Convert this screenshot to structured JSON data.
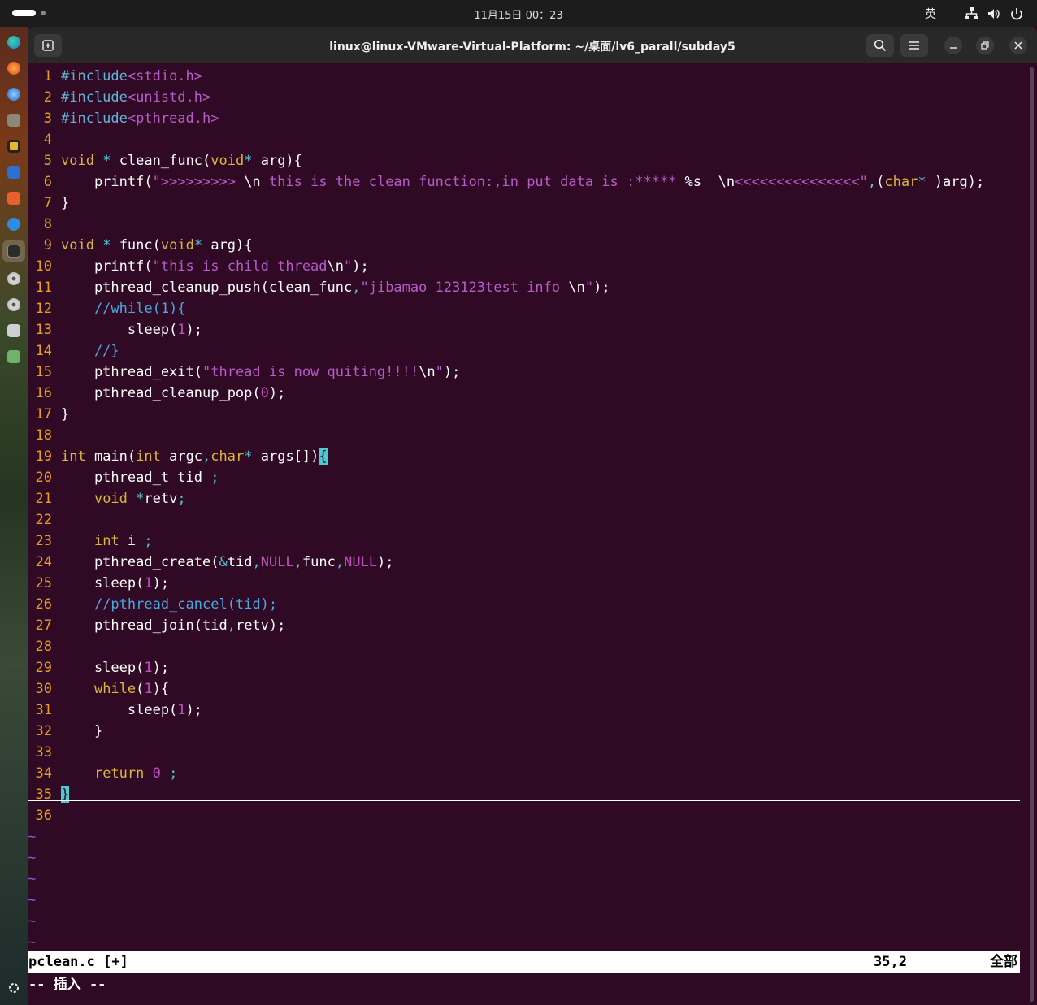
{
  "topbar": {
    "date": "11月15日",
    "time": "00：23",
    "input_method": "英",
    "tray_icons": [
      "network-icon",
      "volume-icon",
      "power-icon"
    ]
  },
  "dock": {
    "apps": [
      "edge-icon",
      "firefox-icon",
      "thunderbird-icon",
      "files-icon",
      "rhythmbox-icon",
      "writer-icon",
      "software-icon",
      "help-icon",
      "terminal-icon",
      "disc-icon",
      "disc-icon",
      "save-icon",
      "trash-icon"
    ],
    "show_apps_icon": "apps-grid-icon"
  },
  "window": {
    "title": "linux@linux-VMware-Virtual-Platform: ~/桌面/lv6_parall/subday5",
    "buttons": [
      "search-icon",
      "menu-icon",
      "minimize-icon",
      "restore-icon",
      "close-icon"
    ]
  },
  "editor": {
    "lines": [
      {
        "n": "1",
        "tokens": [
          {
            "t": "#include",
            "c": "pp"
          },
          {
            "t": "<stdio.h>",
            "c": "str"
          }
        ]
      },
      {
        "n": "2",
        "tokens": [
          {
            "t": "#include",
            "c": "pp"
          },
          {
            "t": "<unistd.h>",
            "c": "str"
          }
        ]
      },
      {
        "n": "3",
        "tokens": [
          {
            "t": "#include",
            "c": "pp"
          },
          {
            "t": "<pthread.h>",
            "c": "str"
          }
        ]
      },
      {
        "n": "4",
        "tokens": []
      },
      {
        "n": "5",
        "tokens": [
          {
            "t": "void",
            "c": "kw"
          },
          {
            "t": " ",
            "c": ""
          },
          {
            "t": "*",
            "c": "op"
          },
          {
            "t": " clean_func(",
            "c": ""
          },
          {
            "t": "void",
            "c": "kw"
          },
          {
            "t": "*",
            "c": "op"
          },
          {
            "t": " arg){",
            "c": ""
          }
        ]
      },
      {
        "n": "6",
        "tokens": [
          {
            "t": "    printf(",
            "c": ""
          },
          {
            "t": "\">>>>>>>>> ",
            "c": "str"
          },
          {
            "t": "\\n",
            "c": ""
          },
          {
            "t": " this is the clean function:,in put data is :***** ",
            "c": "str"
          },
          {
            "t": "%s",
            "c": ""
          },
          {
            "t": "  ",
            "c": "str"
          },
          {
            "t": "\\n",
            "c": ""
          },
          {
            "t": "<<<<<<<<<<<<<<<\"",
            "c": "str"
          },
          {
            "t": ",",
            "c": "op"
          },
          {
            "t": "(",
            "c": ""
          },
          {
            "t": "char",
            "c": "kw"
          },
          {
            "t": "*",
            "c": "op"
          },
          {
            "t": " )arg);",
            "c": ""
          }
        ]
      },
      {
        "n": "7",
        "tokens": [
          {
            "t": "}",
            "c": ""
          }
        ]
      },
      {
        "n": "8",
        "tokens": []
      },
      {
        "n": "9",
        "tokens": [
          {
            "t": "void",
            "c": "kw"
          },
          {
            "t": " ",
            "c": ""
          },
          {
            "t": "*",
            "c": "op"
          },
          {
            "t": " func(",
            "c": ""
          },
          {
            "t": "void",
            "c": "kw"
          },
          {
            "t": "*",
            "c": "op"
          },
          {
            "t": " arg){",
            "c": ""
          }
        ]
      },
      {
        "n": "10",
        "tokens": [
          {
            "t": "    printf(",
            "c": ""
          },
          {
            "t": "\"this is child thread",
            "c": "str"
          },
          {
            "t": "\\n",
            "c": ""
          },
          {
            "t": "\"",
            "c": "str"
          },
          {
            "t": ");",
            "c": ""
          }
        ]
      },
      {
        "n": "11",
        "tokens": [
          {
            "t": "    pthread_cleanup_push(clean_func",
            "c": ""
          },
          {
            "t": ",",
            "c": "op"
          },
          {
            "t": "\"jibamao 123123test info ",
            "c": "str"
          },
          {
            "t": "\\n",
            "c": ""
          },
          {
            "t": "\"",
            "c": "str"
          },
          {
            "t": ");",
            "c": ""
          }
        ]
      },
      {
        "n": "12",
        "tokens": [
          {
            "t": "    //while(1){",
            "c": "com"
          }
        ]
      },
      {
        "n": "13",
        "tokens": [
          {
            "t": "        sleep(",
            "c": ""
          },
          {
            "t": "1",
            "c": "num"
          },
          {
            "t": ");",
            "c": ""
          }
        ]
      },
      {
        "n": "14",
        "tokens": [
          {
            "t": "    //}",
            "c": "com"
          }
        ]
      },
      {
        "n": "15",
        "tokens": [
          {
            "t": "    pthread_exit(",
            "c": ""
          },
          {
            "t": "\"thread is now quiting!!!!",
            "c": "str"
          },
          {
            "t": "\\n",
            "c": ""
          },
          {
            "t": "\"",
            "c": "str"
          },
          {
            "t": ");",
            "c": ""
          }
        ]
      },
      {
        "n": "16",
        "tokens": [
          {
            "t": "    pthread_cleanup_pop(",
            "c": ""
          },
          {
            "t": "0",
            "c": "num"
          },
          {
            "t": ");",
            "c": ""
          }
        ]
      },
      {
        "n": "17",
        "tokens": [
          {
            "t": "}",
            "c": ""
          }
        ]
      },
      {
        "n": "18",
        "tokens": []
      },
      {
        "n": "19",
        "tokens": [
          {
            "t": "int",
            "c": "kw"
          },
          {
            "t": " main(",
            "c": ""
          },
          {
            "t": "int",
            "c": "kw"
          },
          {
            "t": " argc",
            "c": ""
          },
          {
            "t": ",",
            "c": "op"
          },
          {
            "t": "char",
            "c": "kw"
          },
          {
            "t": "*",
            "c": "op"
          },
          {
            "t": " args[])",
            "c": ""
          },
          {
            "t": "{",
            "c": "cursor"
          }
        ]
      },
      {
        "n": "20",
        "tokens": [
          {
            "t": "    pthread_t tid ",
            "c": ""
          },
          {
            "t": ";",
            "c": "op"
          }
        ]
      },
      {
        "n": "21",
        "tokens": [
          {
            "t": "    ",
            "c": ""
          },
          {
            "t": "void",
            "c": "kw"
          },
          {
            "t": " ",
            "c": ""
          },
          {
            "t": "*",
            "c": "op"
          },
          {
            "t": "retv",
            "c": ""
          },
          {
            "t": ";",
            "c": "op"
          }
        ]
      },
      {
        "n": "22",
        "tokens": []
      },
      {
        "n": "23",
        "tokens": [
          {
            "t": "    ",
            "c": ""
          },
          {
            "t": "int",
            "c": "kw"
          },
          {
            "t": " i ",
            "c": ""
          },
          {
            "t": ";",
            "c": "op"
          }
        ]
      },
      {
        "n": "24",
        "tokens": [
          {
            "t": "    pthread_create(",
            "c": ""
          },
          {
            "t": "&",
            "c": "op"
          },
          {
            "t": "tid",
            "c": ""
          },
          {
            "t": ",",
            "c": "op"
          },
          {
            "t": "NULL",
            "c": "num"
          },
          {
            "t": ",",
            "c": "op"
          },
          {
            "t": "func",
            "c": ""
          },
          {
            "t": ",",
            "c": "op"
          },
          {
            "t": "NULL",
            "c": "num"
          },
          {
            "t": ");",
            "c": ""
          }
        ]
      },
      {
        "n": "25",
        "tokens": [
          {
            "t": "    sleep(",
            "c": ""
          },
          {
            "t": "1",
            "c": "num"
          },
          {
            "t": ");",
            "c": ""
          }
        ]
      },
      {
        "n": "26",
        "tokens": [
          {
            "t": "    //pthread_cancel(tid);",
            "c": "com"
          }
        ]
      },
      {
        "n": "27",
        "tokens": [
          {
            "t": "    pthread_join(tid",
            "c": ""
          },
          {
            "t": ",",
            "c": "op"
          },
          {
            "t": "retv);",
            "c": ""
          }
        ]
      },
      {
        "n": "28",
        "tokens": []
      },
      {
        "n": "29",
        "tokens": [
          {
            "t": "    sleep(",
            "c": ""
          },
          {
            "t": "1",
            "c": "num"
          },
          {
            "t": ");",
            "c": ""
          }
        ]
      },
      {
        "n": "30",
        "tokens": [
          {
            "t": "    ",
            "c": ""
          },
          {
            "t": "while",
            "c": "kw"
          },
          {
            "t": "(",
            "c": ""
          },
          {
            "t": "1",
            "c": "num"
          },
          {
            "t": "){",
            "c": ""
          }
        ]
      },
      {
        "n": "31",
        "tokens": [
          {
            "t": "        sleep(",
            "c": ""
          },
          {
            "t": "1",
            "c": "num"
          },
          {
            "t": ");",
            "c": ""
          }
        ]
      },
      {
        "n": "32",
        "tokens": [
          {
            "t": "    }",
            "c": ""
          }
        ]
      },
      {
        "n": "33",
        "tokens": []
      },
      {
        "n": "34",
        "tokens": [
          {
            "t": "    ",
            "c": ""
          },
          {
            "t": "return",
            "c": "kw"
          },
          {
            "t": " ",
            "c": ""
          },
          {
            "t": "0",
            "c": "num"
          },
          {
            "t": " ",
            "c": ""
          },
          {
            "t": ";",
            "c": "op"
          }
        ]
      },
      {
        "n": "35",
        "tokens": [
          {
            "t": "}",
            "c": "cursor"
          }
        ]
      },
      {
        "n": "36",
        "tokens": []
      }
    ],
    "tilde_rows": [
      "~",
      "~",
      "~",
      "~",
      "~",
      "~"
    ]
  },
  "statusline": {
    "filename": "pclean.c [+]",
    "position": "35,2",
    "percent": "全部"
  },
  "mode": "-- 插入 --",
  "colors": {
    "background": "#300a24",
    "line_number": "#e6a01a",
    "keyword": "#d9b73a",
    "string": "#b65cc8",
    "preprocessor": "#5fb6d6",
    "comment": "#4aa8e0",
    "operator": "#4ec9d0"
  }
}
